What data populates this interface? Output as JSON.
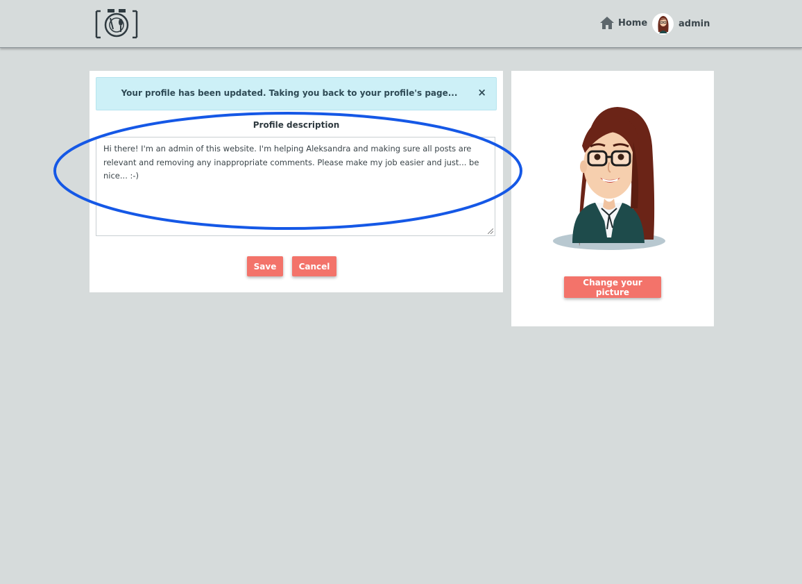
{
  "navbar": {
    "logo_icon": "camera-plate-logo",
    "home_label": "Home",
    "user_label": "admin"
  },
  "alert": {
    "message": "Your profile has been updated. Taking you back to your profile's page...",
    "close_symbol": "×"
  },
  "form": {
    "description_label": "Profile description",
    "description_value": "Hi there! I'm an admin of this website. I'm helping Aleksandra and making sure all posts are relevant and removing any inappropriate comments. Please make my job easier and just... be nice... :-)",
    "save_label": "Save",
    "cancel_label": "Cancel"
  },
  "picture": {
    "change_label": "Change your picture"
  },
  "colors": {
    "background": "#d6dbdb",
    "accent_button": "#f3736a",
    "alert_bg": "#cdf0f7",
    "annotation_ring": "#1558e6"
  }
}
